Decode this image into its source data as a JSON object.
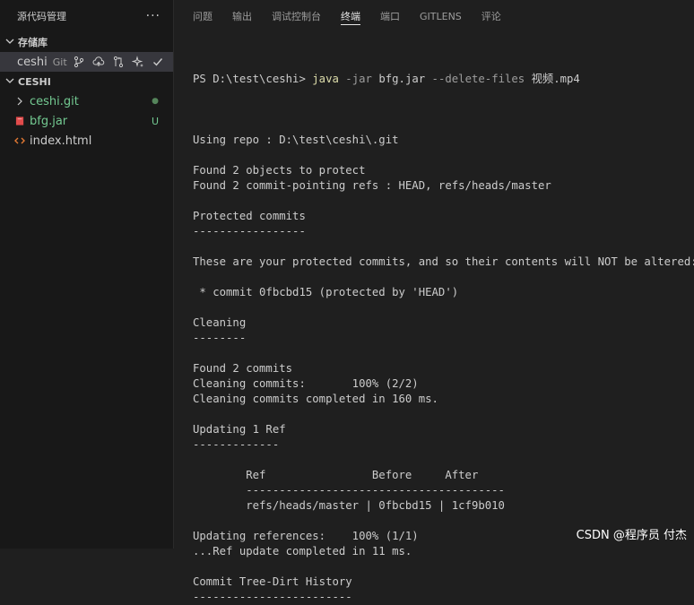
{
  "sidebar": {
    "title": "源代码管理",
    "more": "···",
    "repos_section": "存储库",
    "repo": {
      "name": "ceshi",
      "scm": "Git"
    },
    "workspace_section": "CESHI",
    "files": [
      {
        "name": "ceshi.git",
        "color": "#73c991",
        "badge": "●",
        "badge_color": "#55855b",
        "icon": "chevron-right-icon"
      },
      {
        "name": "bfg.jar",
        "color": "#73c991",
        "badge": "U",
        "badge_color": "#73c991",
        "icon": "jar-file-icon"
      },
      {
        "name": "index.html",
        "color": "#cccccc",
        "badge": "",
        "badge_color": "#cccccc",
        "icon": "html-file-icon"
      }
    ]
  },
  "tabs": [
    "问题",
    "输出",
    "调试控制台",
    "终端",
    "端口",
    "GITLENS",
    "评论"
  ],
  "active_tab": "终端",
  "terminal": {
    "prompt": "PS D:\\test\\ceshi> ",
    "cmd": "java",
    "flag": " -jar",
    "arg1": " bfg.jar",
    "flag2": " --delete-files",
    "arg2": " 视频.mp4",
    "lines": [
      "",
      "Using repo : D:\\test\\ceshi\\.git",
      "",
      "Found 2 objects to protect",
      "Found 2 commit-pointing refs : HEAD, refs/heads/master",
      "",
      "Protected commits",
      "-----------------",
      "",
      "These are your protected commits, and so their contents will NOT be altered:",
      "",
      " * commit 0fbcbd15 (protected by 'HEAD')",
      "",
      "Cleaning",
      "--------",
      "",
      "Found 2 commits",
      "Cleaning commits:       100% (2/2)",
      "Cleaning commits completed in 160 ms.",
      "",
      "Updating 1 Ref",
      "-------------",
      "",
      "        Ref                Before     After",
      "        ---------------------------------------",
      "        refs/heads/master | 0fbcbd15 | 1cf9b010",
      "",
      "Updating references:    100% (1/1)",
      "...Ref update completed in 11 ms.",
      "",
      "Commit Tree-Dirt History",
      "------------------------"
    ]
  },
  "watermark": "CSDN @程序员 付杰"
}
